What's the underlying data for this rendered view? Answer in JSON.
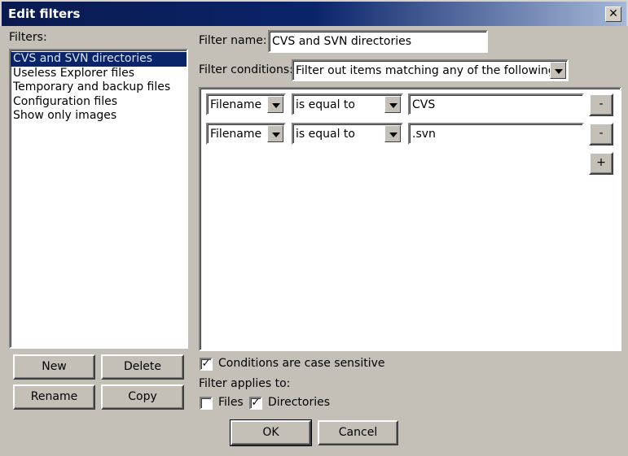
{
  "window": {
    "title": "Edit filters",
    "close": "✕"
  },
  "filters": {
    "label": "Filters:",
    "items": [
      "CVS and SVN directories",
      "Useless Explorer files",
      "Temporary and backup files",
      "Configuration files",
      "Show only images"
    ],
    "selected_index": 0
  },
  "buttons": {
    "new": "New",
    "delete": "Delete",
    "rename": "Rename",
    "copy": "Copy",
    "ok": "OK",
    "cancel": "Cancel"
  },
  "filter_name": {
    "label": "Filter name:",
    "value": "CVS and SVN directories"
  },
  "filter_conditions": {
    "label": "Filter conditions:",
    "value": "Filter out items matching any of the following"
  },
  "conditions": [
    {
      "field": "Filename",
      "operator": "is equal to",
      "value": "CVS",
      "remove": "-"
    },
    {
      "field": "Filename",
      "operator": "is equal to",
      "value": ".svn",
      "remove": "-"
    }
  ],
  "add_condition": "+",
  "case_sensitive": {
    "label": "Conditions are case sensitive",
    "checked": true
  },
  "applies_to": {
    "label": "Filter applies to:",
    "files": {
      "label": "Files",
      "checked": false
    },
    "directories": {
      "label": "Directories",
      "checked": true
    }
  }
}
